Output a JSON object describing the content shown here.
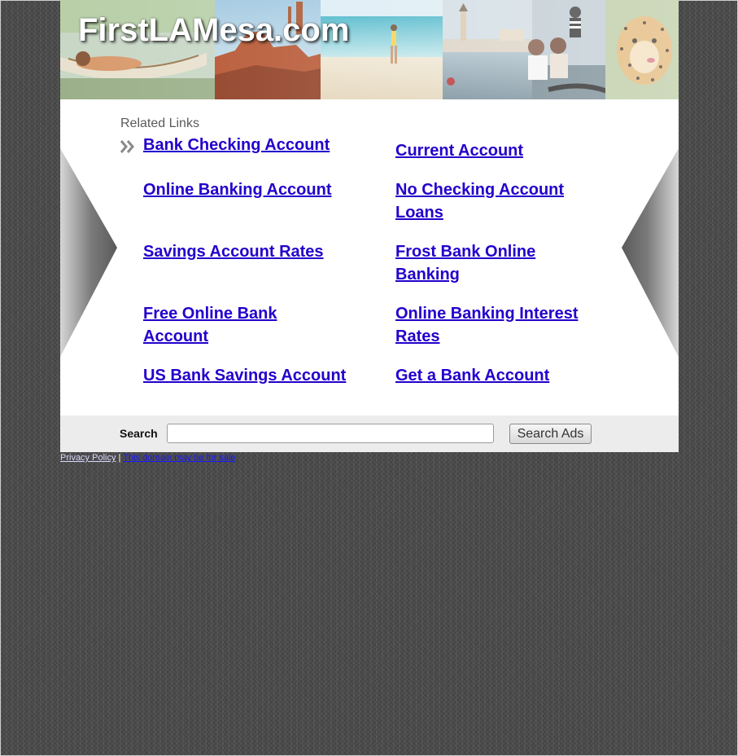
{
  "header": {
    "site_title": "FirstLAMesa.com"
  },
  "content": {
    "related_heading": "Related Links",
    "links": [
      {
        "label": "Bank Checking Account"
      },
      {
        "label": "Current Account"
      },
      {
        "label": "Online Banking Account"
      },
      {
        "label": "No Checking Account Loans"
      },
      {
        "label": "Savings Account Rates"
      },
      {
        "label": "Frost Bank Online Banking"
      },
      {
        "label": "Free Online Bank Account"
      },
      {
        "label": "Online Banking Interest Rates"
      },
      {
        "label": "US Bank Savings Account"
      },
      {
        "label": "Get a Bank Account"
      }
    ]
  },
  "search": {
    "label": "Search",
    "value": "",
    "button_label": "Search Ads"
  },
  "footer": {
    "privacy_label": "Privacy Policy",
    "separator": "|",
    "sale_label": "This domain may be for sale"
  },
  "colors": {
    "link": "#2200cc",
    "content_bg": "#ffffff",
    "search_bar_bg": "#ececec",
    "page_bg": "#4a4a4a"
  }
}
